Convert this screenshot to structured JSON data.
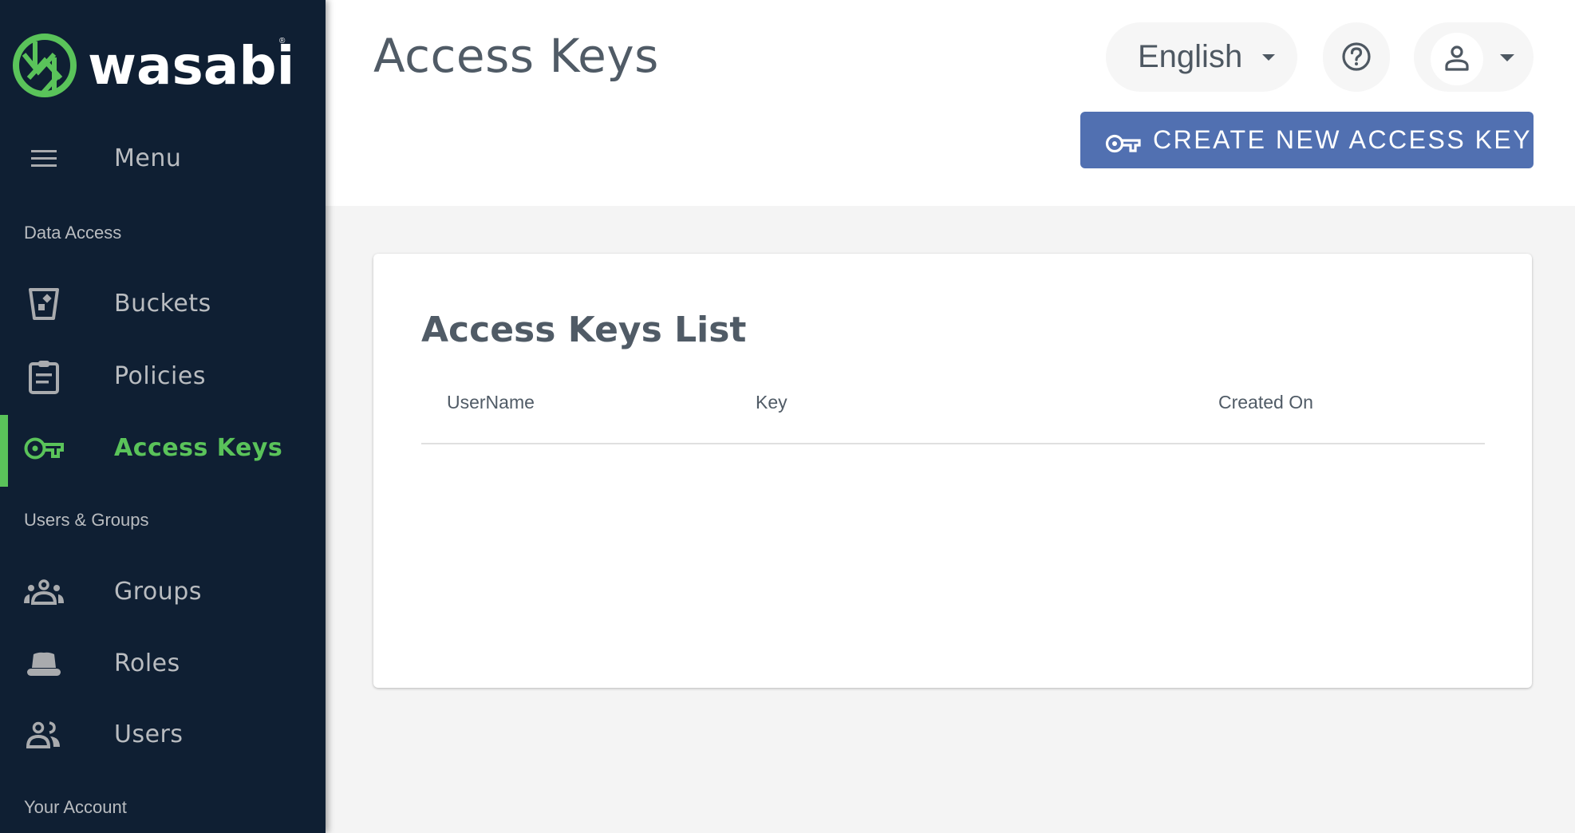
{
  "brand": {
    "name": "wasabi",
    "registered_mark": "®",
    "accent_color": "#5ac35a",
    "sidebar_bg": "#0f1f33"
  },
  "sidebar": {
    "menu_label": "Menu",
    "sections": [
      {
        "label": "Data Access",
        "items": [
          {
            "label": "Buckets",
            "icon": "bucket-icon",
            "active": false
          },
          {
            "label": "Policies",
            "icon": "clipboard-icon",
            "active": false
          },
          {
            "label": "Access Keys",
            "icon": "key-icon",
            "active": true
          }
        ]
      },
      {
        "label": "Users & Groups",
        "items": [
          {
            "label": "Groups",
            "icon": "groups-icon",
            "active": false
          },
          {
            "label": "Roles",
            "icon": "hat-icon",
            "active": false
          },
          {
            "label": "Users",
            "icon": "users-icon",
            "active": false
          }
        ]
      },
      {
        "label": "Your Account",
        "items": []
      }
    ]
  },
  "header": {
    "title": "Access Keys",
    "language": "English",
    "help_icon": "help-circle-icon",
    "user_icon": "person-icon",
    "create_button_label": "CREATE NEW ACCESS KEY",
    "create_button_color": "#5170b1"
  },
  "card": {
    "title": "Access Keys List",
    "columns": [
      "UserName",
      "Key",
      "Created On"
    ],
    "rows": []
  }
}
